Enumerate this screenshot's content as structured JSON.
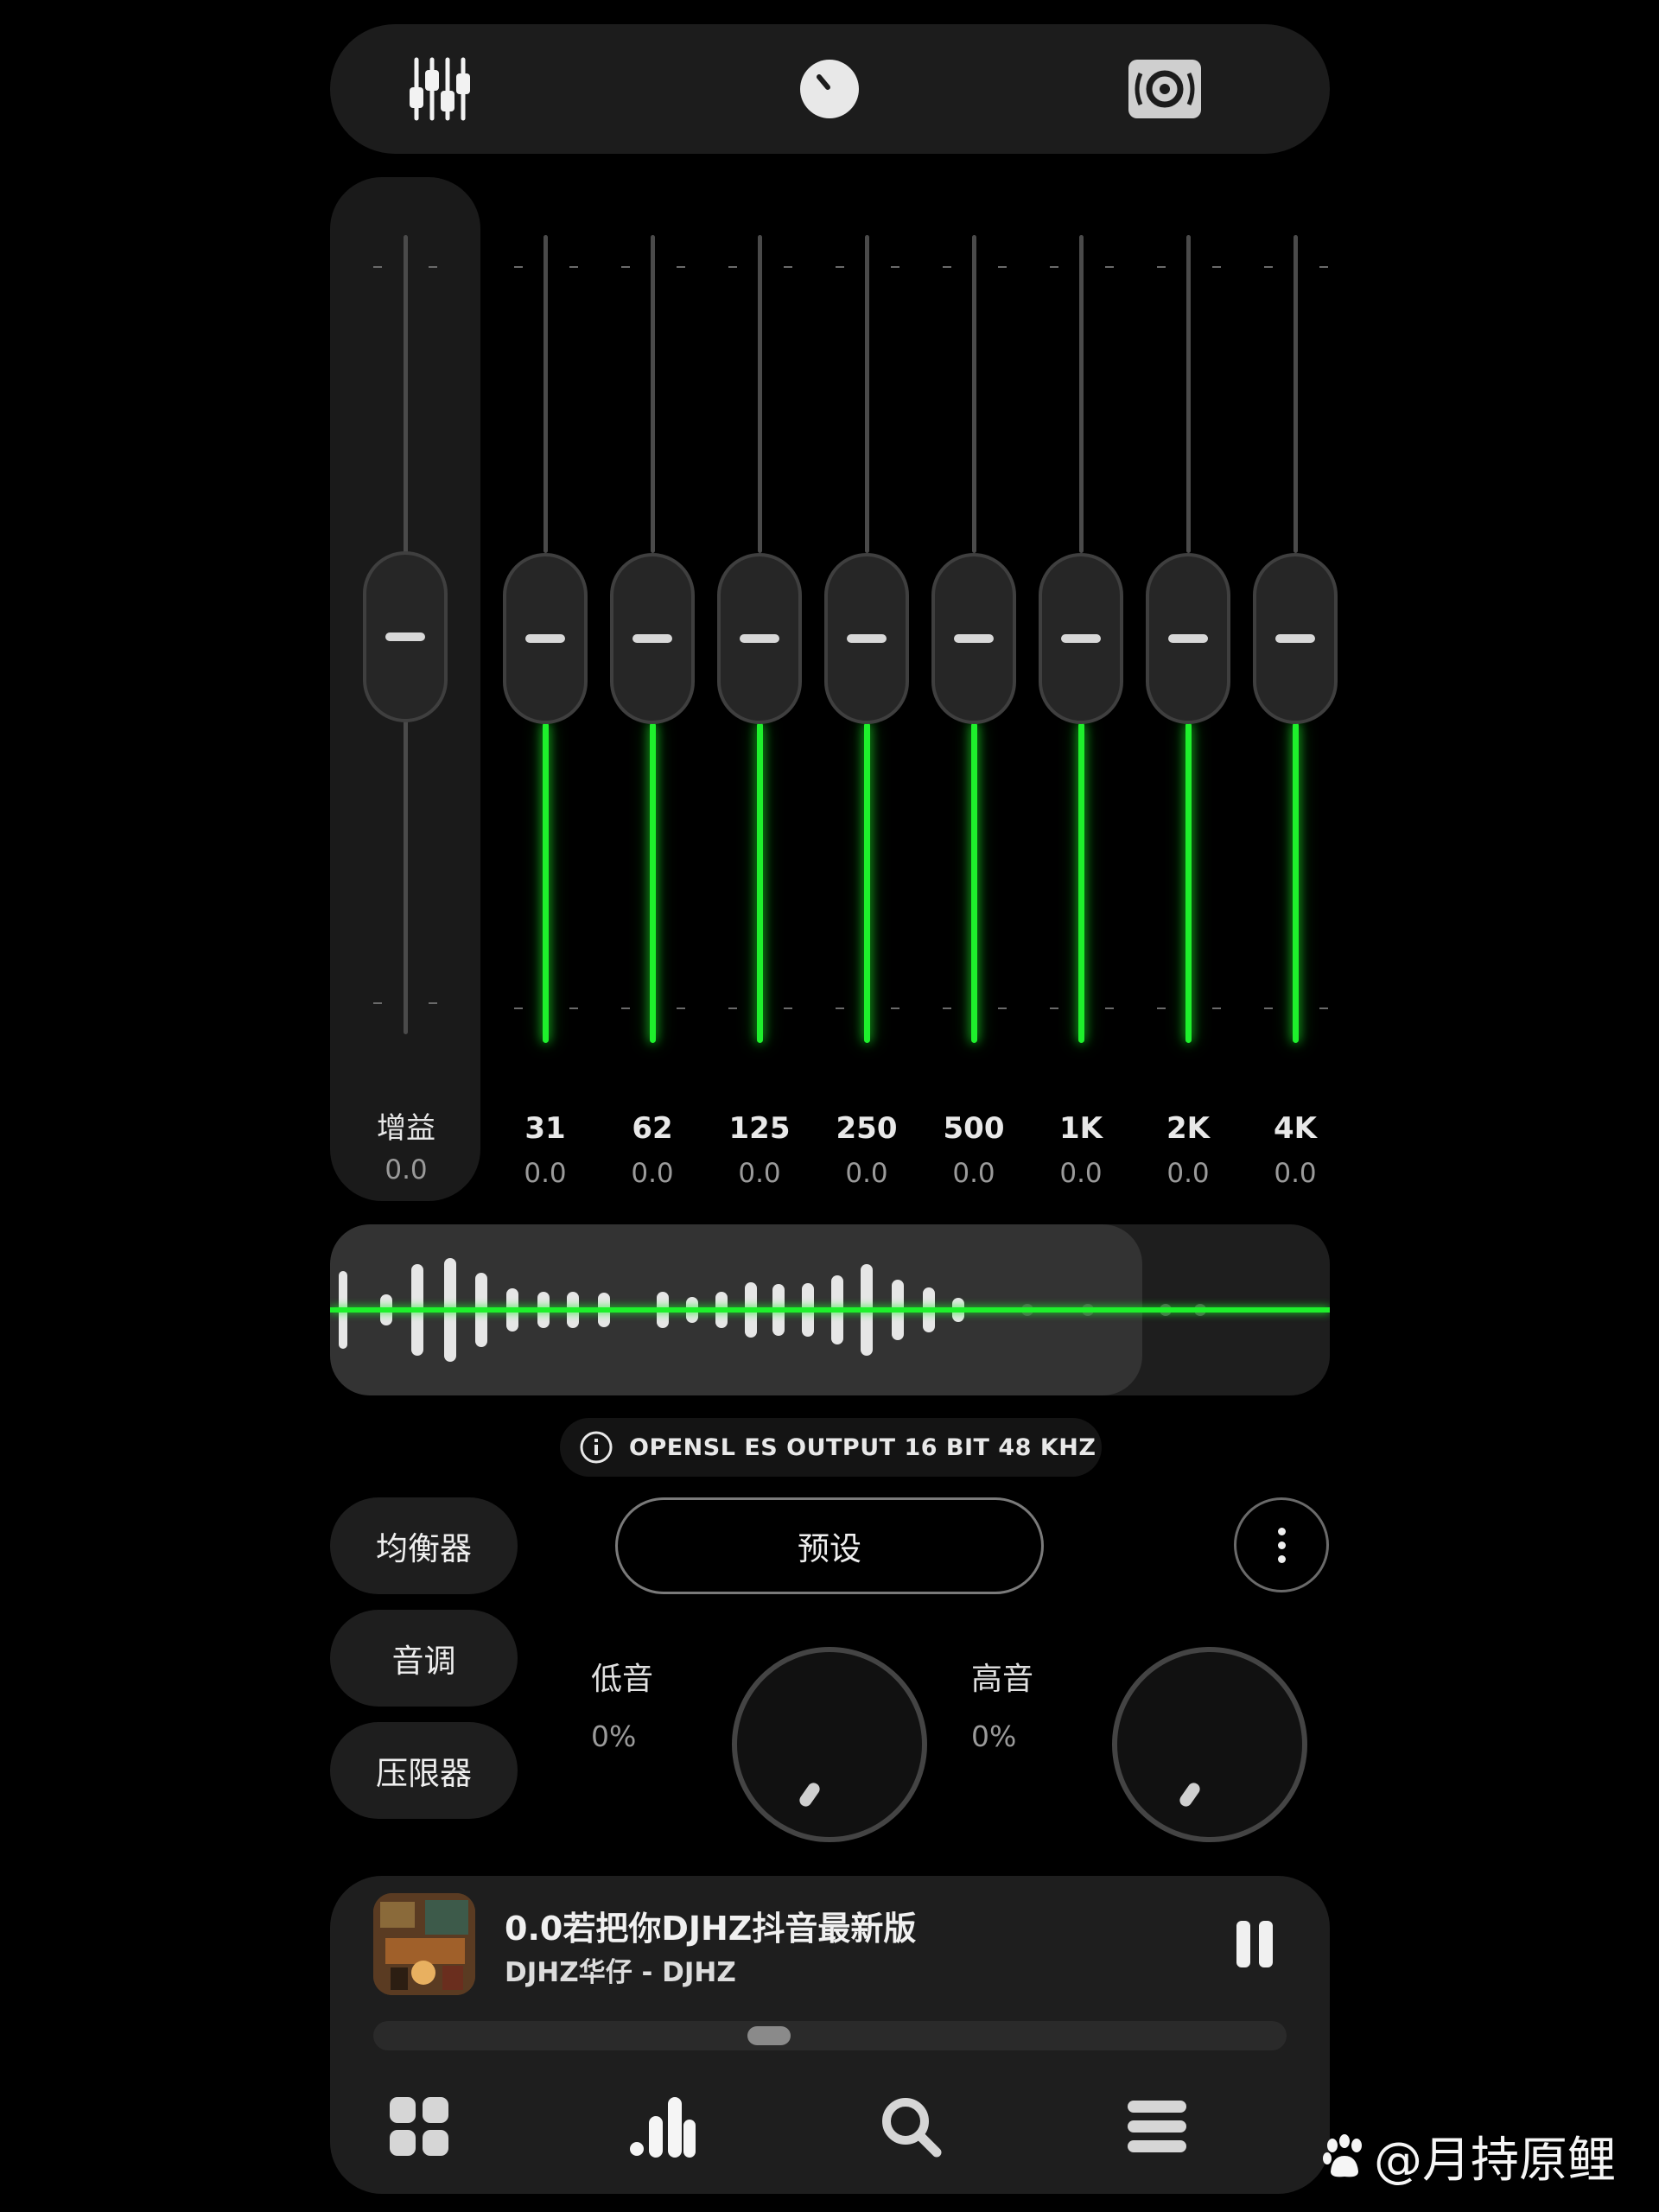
{
  "tabs": [
    {
      "icon": "equalizer-sliders-icon",
      "name": "tab-equalizer"
    },
    {
      "icon": "knob-icon",
      "name": "tab-effects"
    },
    {
      "icon": "speaker-icon",
      "name": "tab-output"
    }
  ],
  "gain": {
    "label": "增益",
    "value": "0.0",
    "level_db": 0.0
  },
  "bands": [
    {
      "label": "31",
      "value": "0.0",
      "level_db": 0.0
    },
    {
      "label": "62",
      "value": "0.0",
      "level_db": 0.0
    },
    {
      "label": "125",
      "value": "0.0",
      "level_db": 0.0
    },
    {
      "label": "250",
      "value": "0.0",
      "level_db": 0.0
    },
    {
      "label": "500",
      "value": "0.0",
      "level_db": 0.0
    },
    {
      "label": "1K",
      "value": "0.0",
      "level_db": 0.0
    },
    {
      "label": "2K",
      "value": "0.0",
      "level_db": 0.0
    },
    {
      "label": "4K",
      "value": "0.0",
      "level_db": 0.0
    }
  ],
  "output_info": {
    "icon": "info-icon",
    "text": "OPENSL ES OUTPUT 16 BIT 48 KHZ"
  },
  "side_buttons": {
    "equalizer": "均衡器",
    "pitch": "音调",
    "limiter": "压限器"
  },
  "preset_button": "预设",
  "more_icon": "more-vertical-icon",
  "bass": {
    "label": "低音",
    "value": "0%",
    "level": 0.0
  },
  "treble": {
    "label": "高音",
    "value": "0%",
    "level": 0.0
  },
  "player": {
    "title": "0.0若把你DJHZ抖音最新版",
    "artist": "DJHZ华仔 - DJHZ",
    "state": "playing",
    "pause_icon": "pause-icon",
    "progress": 0.43
  },
  "bottom_nav": [
    {
      "icon": "grid-icon"
    },
    {
      "icon": "visualizer-bars-icon",
      "active": true
    },
    {
      "icon": "search-icon"
    },
    {
      "icon": "menu-icon"
    }
  ],
  "colors": {
    "accent": "#1ef02c",
    "background": "#000000",
    "panel": "#1c1c1c"
  },
  "watermark": "@月持原鲤"
}
